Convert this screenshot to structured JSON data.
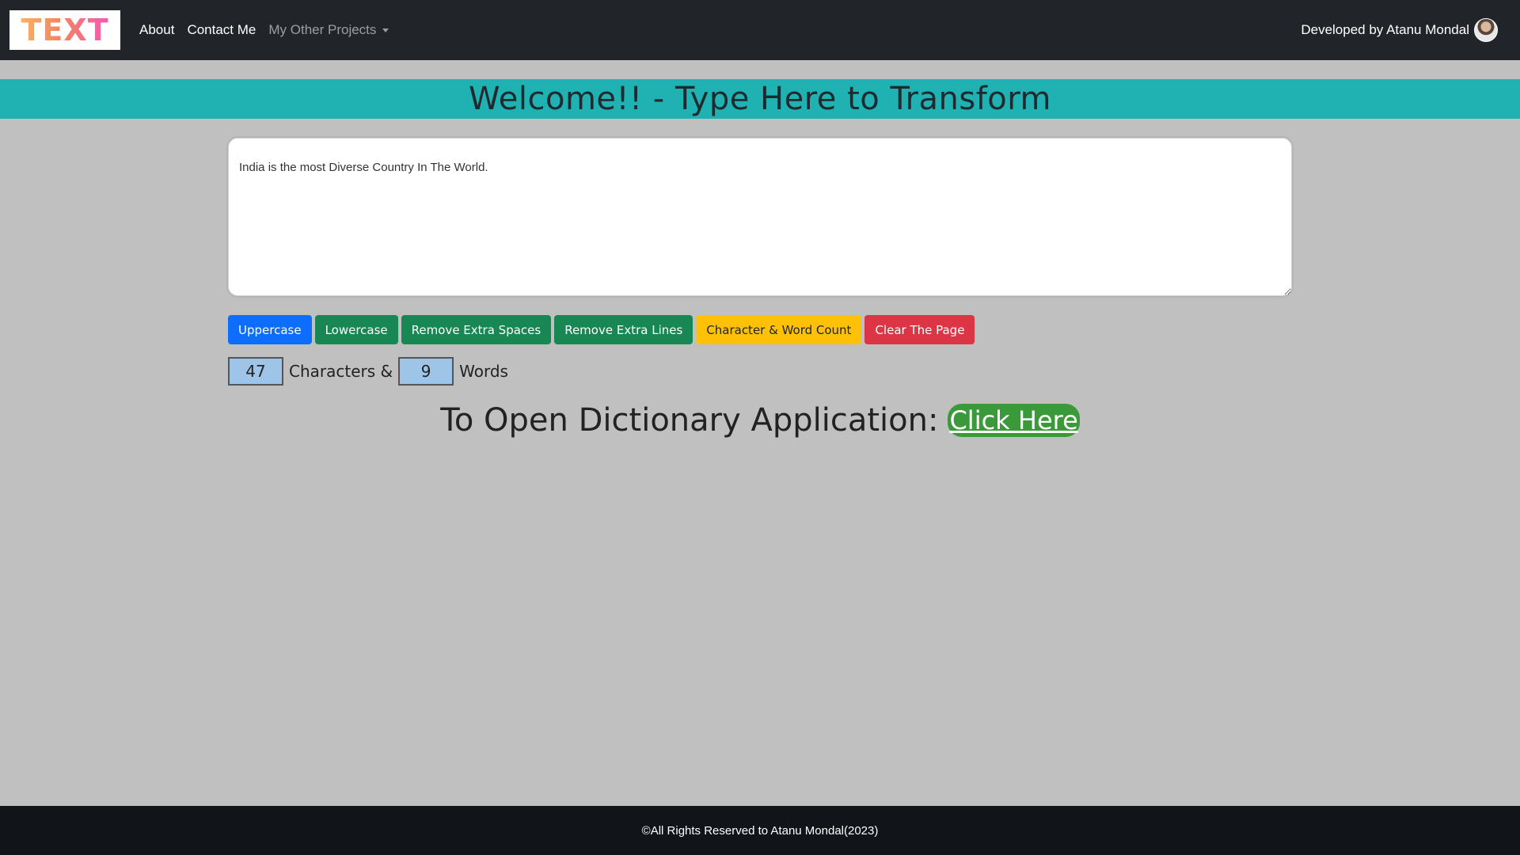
{
  "navbar": {
    "brand": "TEXT",
    "links": [
      "About",
      "Contact Me"
    ],
    "dropdown_label": "My Other Projects",
    "developer": "Developed by Atanu Mondal"
  },
  "banner": {
    "title": "Welcome!! - Type Here to Transform"
  },
  "editor": {
    "value": "India is the most Diverse Country In The World."
  },
  "buttons": {
    "uppercase": "Uppercase",
    "lowercase": "Lowercase",
    "remove_spaces": "Remove Extra Spaces",
    "remove_lines": "Remove Extra Lines",
    "count": "Character & Word Count",
    "clear": "Clear The Page"
  },
  "counts": {
    "characters": "47",
    "characters_label": "Characters &",
    "words": "9",
    "words_label": "Words"
  },
  "dictionary": {
    "text": "To Open Dictionary Application:",
    "link": "Click Here"
  },
  "footer": {
    "text": "©All Rights Reserved to Atanu Mondal(2023)"
  },
  "colors": {
    "navbar_bg": "#212529",
    "banner_bg": "#20b2b2",
    "page_bg": "#c0c0c0",
    "primary": "#0d6efd",
    "success": "#198754",
    "warning": "#ffc107",
    "danger": "#dc3545",
    "link_bg": "#3a9a3a"
  }
}
